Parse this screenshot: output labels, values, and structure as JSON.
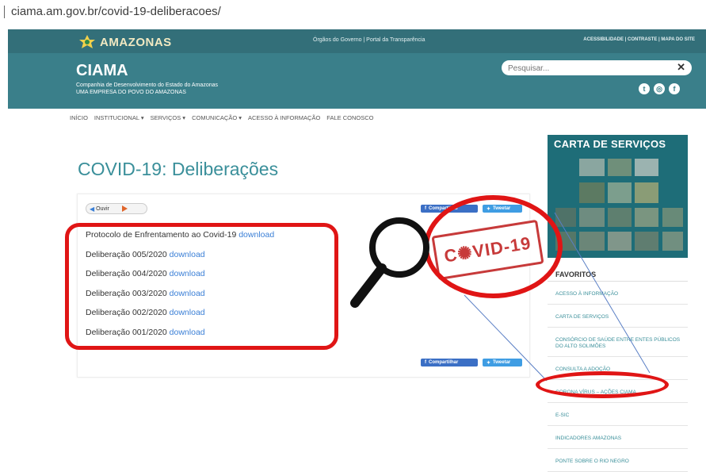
{
  "browser": {
    "url": "ciama.am.gov.br/covid-19-deliberacoes/"
  },
  "header": {
    "logo_text": "AMAZONAS",
    "gov_links": "Órgãos do Governo  |  Portal da Transparência",
    "access_links": "ACESSIBILIDADE | CONTRASTE | MAPA DO SITE",
    "brand": "CIAMA",
    "tagline1": "Companhia de Desenvolvimento do Estado do Amazonas",
    "tagline2": "UMA EMPRESA DO POVO DO AMAZONAS",
    "search_placeholder": "Pesquisar...",
    "clear_symbol": "✕"
  },
  "nav": {
    "items": [
      "INÍCIO",
      "INSTITUCIONAL ▾",
      "SERVIÇOS ▾",
      "COMUNICAÇÃO ▾",
      "ACESSO À INFORMAÇÃO",
      "FALE CONOSCO"
    ]
  },
  "page": {
    "title": "COVID-19: Deliberações",
    "audio_label": "Ouvir",
    "share_facebook": "Compartilhar",
    "share_twitter": "Tweetar",
    "documents": [
      {
        "name": "Protocolo de Enfrentamento ao Covid-19",
        "link": "download"
      },
      {
        "name": "Deliberação 005/2020",
        "link": "download"
      },
      {
        "name": "Deliberação 004/2020",
        "link": "download"
      },
      {
        "name": "Deliberação 003/2020",
        "link": "download"
      },
      {
        "name": "Deliberação 002/2020",
        "link": "download"
      },
      {
        "name": "Deliberação 001/2020",
        "link": "download"
      }
    ]
  },
  "sidebar": {
    "banner_title": "CARTA DE SERVIÇOS",
    "favorites_title": "FAVORITOS",
    "favorites": [
      "ACESSO À INFORMAÇÃO",
      "CARTA DE SERVIÇOS",
      "CONSÓRCIO DE SAÚDE ENTRE ENTES PÚBLICOS DO ALTO SOLIMÕES",
      "CONSULTA A ADOÇÃO",
      "CORONA VÍRUS – AÇÕES CIAMA",
      "E-SIC",
      "INDICADORES AMAZONAS",
      "PONTE SOBRE O RIO NEGRO"
    ]
  },
  "overlay": {
    "stamp_text": "C✺VID-19",
    "ring_color": "#e01515",
    "stamp_color": "#c73a3a"
  },
  "colors": {
    "header": "#3a7f8a",
    "title": "#3a8f9a",
    "link": "#3a7fd6"
  }
}
